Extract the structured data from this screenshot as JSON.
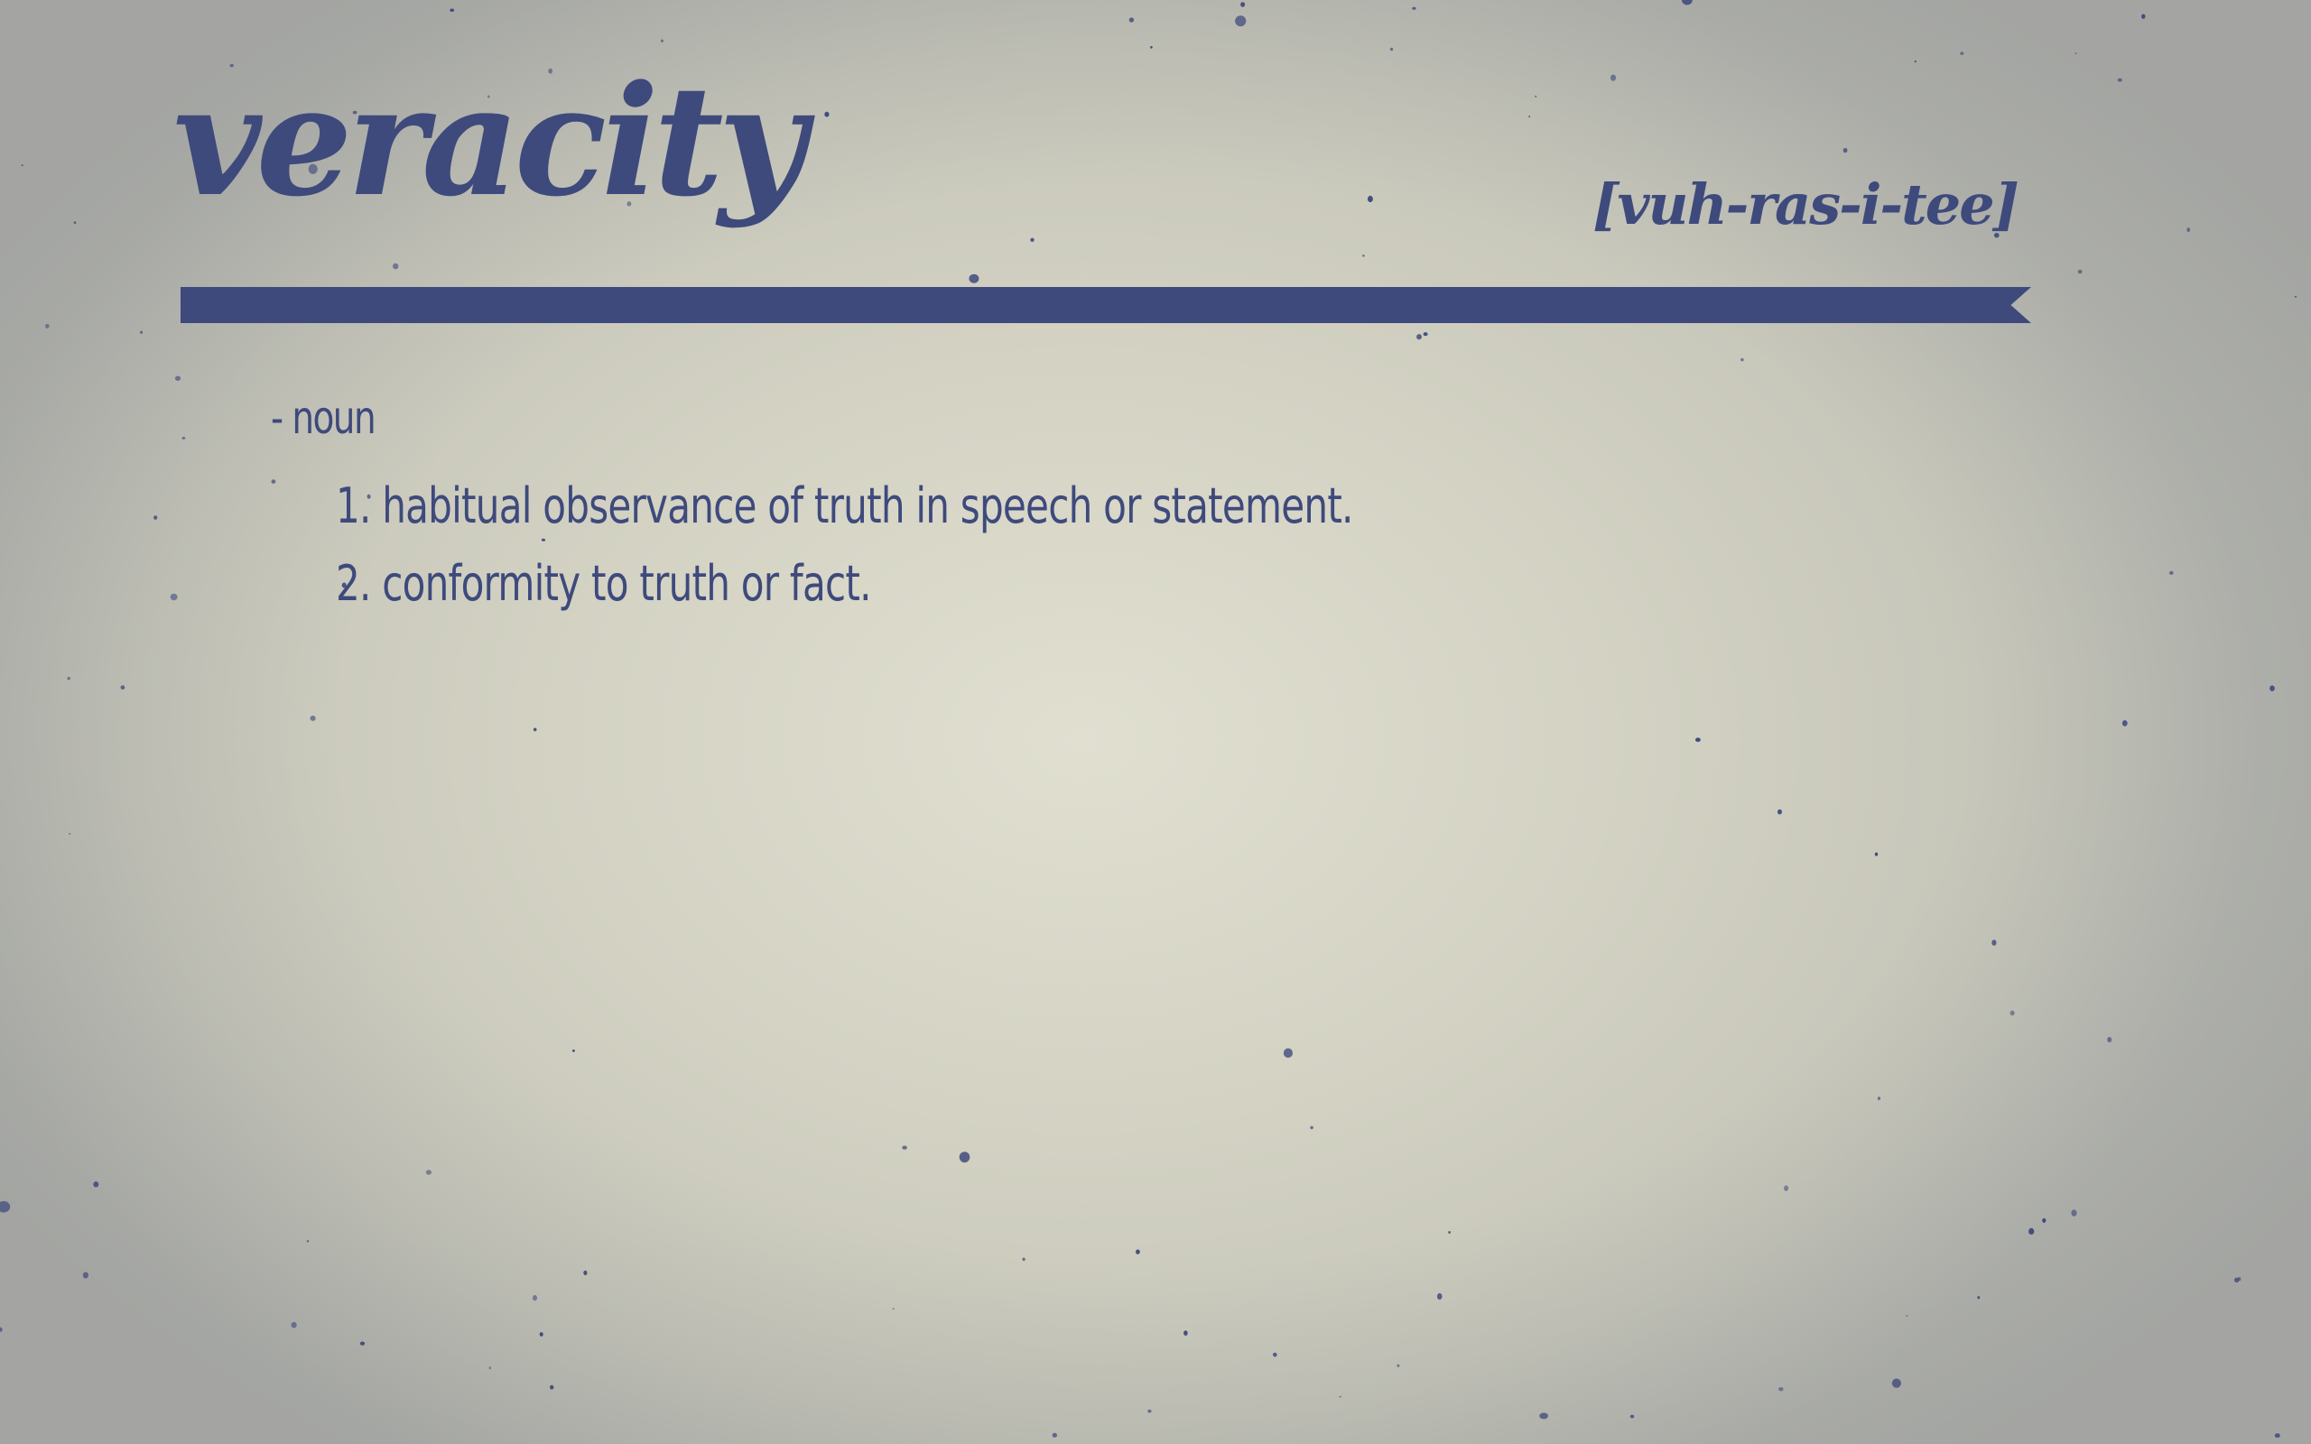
{
  "entry": {
    "word": "veracity",
    "pronunciation": "[vuh-ras-i-tee]",
    "part_of_speech": "- noun",
    "definitions": [
      "1. habitual observance of truth in speech or statement.",
      "2. conformity to truth or fact."
    ]
  },
  "colors": {
    "ink": "#3e4a7c",
    "paper": "#d6d5c6"
  }
}
